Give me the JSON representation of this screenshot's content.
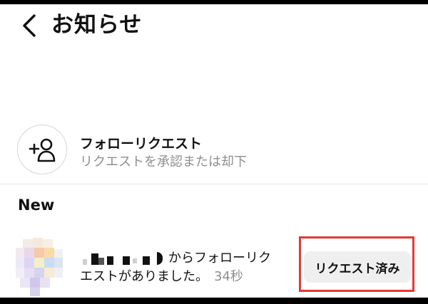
{
  "header": {
    "title": "お知らせ",
    "back_icon": "chevron-left-icon"
  },
  "follow_requests": {
    "icon": "add-person-icon",
    "title": "フォローリクエスト",
    "subtitle": "リクエストを承認または却下"
  },
  "section_label": "New",
  "notification": {
    "line1_suffix": "からフォローリク",
    "line2": "エストがありました。",
    "time": "34秒",
    "button_label": "リクエスト済み"
  },
  "colors": {
    "highlight_border": "#e53935",
    "secondary_text": "#8e8e8e",
    "button_bg": "#efefef"
  }
}
